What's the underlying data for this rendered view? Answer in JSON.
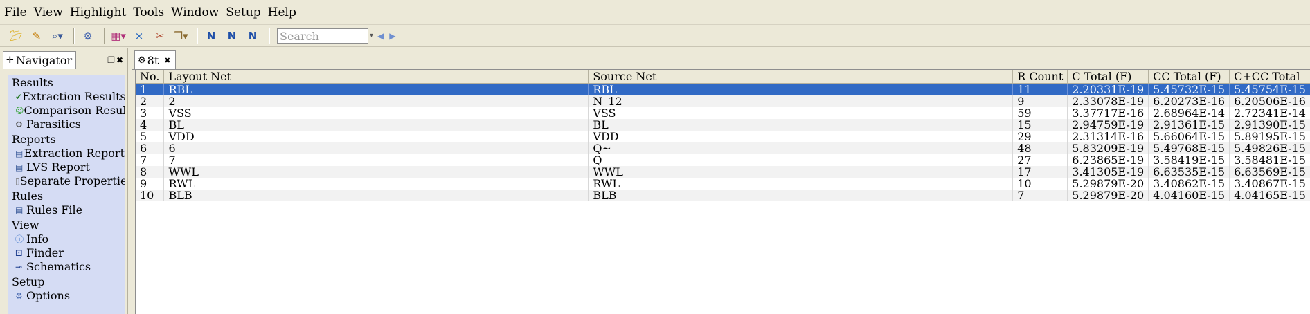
{
  "menu": [
    {
      "label": "File"
    },
    {
      "label": "View"
    },
    {
      "label": "Highlight"
    },
    {
      "label": "Tools"
    },
    {
      "label": "Window"
    },
    {
      "label": "Setup"
    },
    {
      "label": "Help"
    }
  ],
  "toolbar": {
    "search_placeholder": "Search"
  },
  "navigator": {
    "title": "Navigator",
    "sections": {
      "results": "Results",
      "reports": "Reports",
      "rules": "Rules",
      "view": "View",
      "setup": "Setup"
    },
    "items": {
      "extraction_results": "Extraction Results",
      "comparison_results": "Comparison Results",
      "parasitics": "Parasitics",
      "extraction_report": "Extraction Report",
      "lvs_report": "LVS Report",
      "separate_properties": "Separate Properties",
      "rules_file": "Rules File",
      "info": "Info",
      "finder": "Finder",
      "schematics": "Schematics",
      "options": "Options"
    }
  },
  "document_tab": {
    "label": "8t"
  },
  "table": {
    "columns": [
      "No.",
      "Layout Net",
      "Source Net",
      "R Count",
      "C Total (F)",
      "CC Total (F)",
      "C+CC Total"
    ],
    "rows": [
      [
        "1",
        "RBL",
        "RBL",
        "11",
        "2.20331E-19",
        "5.45732E-15",
        "5.45754E-15"
      ],
      [
        "2",
        "2",
        "N_12",
        "9",
        "2.33078E-19",
        "6.20273E-16",
        "6.20506E-16"
      ],
      [
        "3",
        "VSS",
        "VSS",
        "59",
        "3.37717E-16",
        "2.68964E-14",
        "2.72341E-14"
      ],
      [
        "4",
        "BL",
        "BL",
        "15",
        "2.94759E-19",
        "2.91361E-15",
        "2.91390E-15"
      ],
      [
        "5",
        "VDD",
        "VDD",
        "29",
        "2.31314E-16",
        "5.66064E-15",
        "5.89195E-15"
      ],
      [
        "6",
        "6",
        "Q~",
        "48",
        "5.83209E-19",
        "5.49768E-15",
        "5.49826E-15"
      ],
      [
        "7",
        "7",
        "Q",
        "27",
        "6.23865E-19",
        "3.58419E-15",
        "3.58481E-15"
      ],
      [
        "8",
        "WWL",
        "WWL",
        "17",
        "3.41305E-19",
        "6.63535E-15",
        "6.63569E-15"
      ],
      [
        "9",
        "RWL",
        "RWL",
        "10",
        "5.29879E-20",
        "3.40862E-15",
        "3.40867E-15"
      ],
      [
        "10",
        "BLB",
        "BLB",
        "7",
        "5.29879E-20",
        "4.04160E-15",
        "4.04165E-15"
      ]
    ],
    "selected_row": 1
  },
  "colors": {
    "selection": "#316ac5",
    "navigator_list_bg": "#d5dcf4",
    "chrome_bg": "#ece9d8"
  },
  "icons": {
    "toolbar": [
      "open-folder-icon",
      "highlight-icon",
      "zoom-icon",
      "gear-icon",
      "color-highlight-icon",
      "filter-icon",
      "clear-highlight-icon",
      "copy-icon",
      "net-info-icon",
      "net-select-icon",
      "net-next-icon"
    ]
  }
}
